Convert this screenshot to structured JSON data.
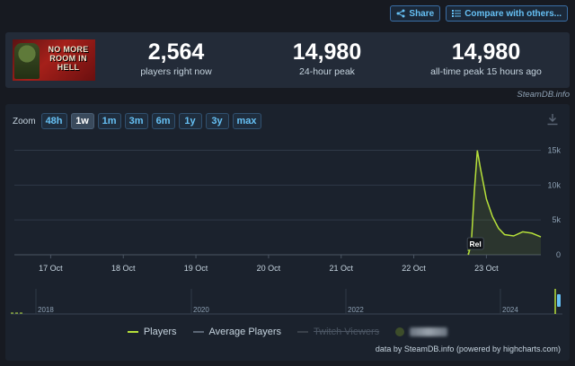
{
  "toolbar": {
    "share_label": "Share",
    "compare_label": "Compare with others...",
    "share_icon": "share-icon",
    "compare_icon": "compare-icon"
  },
  "game": {
    "logo_text": "NO MORE ROOM IN HELL"
  },
  "stats": {
    "current": {
      "value": "2,564",
      "label": "players right now"
    },
    "peak24": {
      "value": "14,980",
      "label": "24-hour peak"
    },
    "alltime": {
      "value": "14,980",
      "label": "all-time peak 15 hours ago"
    }
  },
  "watermark": "SteamDB.info",
  "zoom": {
    "label": "Zoom",
    "options": [
      "48h",
      "1w",
      "1m",
      "3m",
      "6m",
      "1y",
      "3y",
      "max"
    ],
    "active": "1w"
  },
  "legend": {
    "players": "Players",
    "average": "Average Players",
    "twitch": "Twitch Viewers"
  },
  "credit": "data by SteamDB.info (powered by highcharts.com)",
  "colors": {
    "players": "#b6e03a",
    "accent": "#66c0f4",
    "grid": "#2f3947"
  },
  "chart_data": {
    "type": "line",
    "x_ticks": [
      "17 Oct",
      "18 Oct",
      "19 Oct",
      "20 Oct",
      "21 Oct",
      "22 Oct",
      "23 Oct"
    ],
    "y_ticks": [
      "0",
      "5k",
      "10k",
      "15k"
    ],
    "ylim": [
      0,
      17000
    ],
    "xlim": [
      "2024-10-16 12:00",
      "2024-10-23 18:00"
    ],
    "series": [
      {
        "name": "Players",
        "points": [
          [
            "2024-10-22 18:00",
            0
          ],
          [
            "2024-10-22 19:00",
            1500
          ],
          [
            "2024-10-22 20:00",
            9000
          ],
          [
            "2024-10-22 21:00",
            14980
          ],
          [
            "2024-10-22 22:00",
            12500
          ],
          [
            "2024-10-23 00:00",
            8000
          ],
          [
            "2024-10-23 02:00",
            5500
          ],
          [
            "2024-10-23 04:00",
            3800
          ],
          [
            "2024-10-23 06:00",
            2900
          ],
          [
            "2024-10-23 09:00",
            2700
          ],
          [
            "2024-10-23 12:00",
            3300
          ],
          [
            "2024-10-23 15:00",
            3100
          ],
          [
            "2024-10-23 18:00",
            2564
          ]
        ]
      }
    ],
    "annotation": "Rel",
    "navigator": {
      "years": [
        "2018",
        "2020",
        "2022",
        "2024"
      ]
    }
  }
}
